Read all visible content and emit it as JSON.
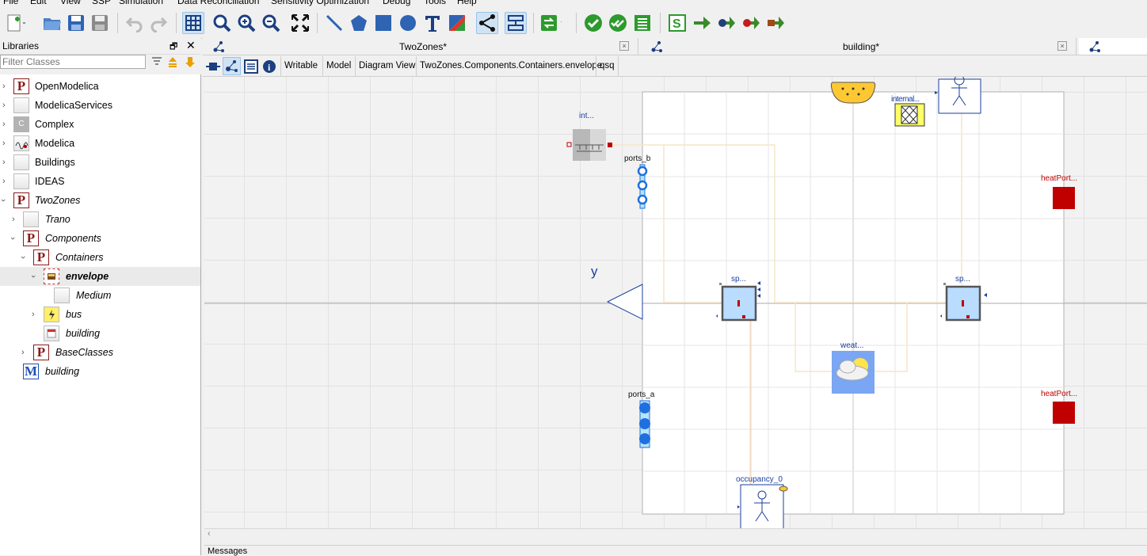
{
  "menu": {
    "items": [
      "File",
      "Edit",
      "View",
      "SSP",
      "Simulation",
      "Data Reconciliation",
      "Sensitivity Optimization",
      "Debug",
      "Tools",
      "Help"
    ]
  },
  "libraries": {
    "title": "Libraries",
    "filter_placeholder": "Filter Classes",
    "tree": [
      {
        "label": "OpenModelica",
        "icon": "package-icon",
        "arrow": "chevron-right-icon"
      },
      {
        "label": "ModelicaServices",
        "icon": "class-icon",
        "arrow": "chevron-right-icon"
      },
      {
        "label": "Complex",
        "icon": "complex-icon",
        "arrow": "chevron-right-icon"
      },
      {
        "label": "Modelica",
        "icon": "modelica-icon",
        "arrow": "chevron-right-icon"
      },
      {
        "label": "Buildings",
        "icon": "class-icon",
        "arrow": "chevron-right-icon"
      },
      {
        "label": "IDEAS",
        "icon": "class-icon",
        "arrow": "chevron-right-icon"
      },
      {
        "label": "TwoZones",
        "icon": "package-icon",
        "arrow": "chevron-down-icon"
      },
      {
        "label": "Trano",
        "icon": "class-icon",
        "arrow": "chevron-right-icon"
      },
      {
        "label": "Components",
        "icon": "package-icon",
        "arrow": "chevron-down-icon"
      },
      {
        "label": "Containers",
        "icon": "package-icon",
        "arrow": "chevron-down-icon"
      },
      {
        "label": "envelope",
        "icon": "envelope-icon",
        "arrow": "chevron-down-icon"
      },
      {
        "label": "Medium",
        "icon": "class-icon",
        "arrow": ""
      },
      {
        "label": "bus",
        "icon": "bus-icon",
        "arrow": "chevron-right-icon"
      },
      {
        "label": "building",
        "icon": "building-icon",
        "arrow": ""
      },
      {
        "label": "BaseClasses",
        "icon": "package-icon",
        "arrow": "chevron-right-icon"
      },
      {
        "label": "building",
        "icon": "model-icon",
        "arrow": ""
      }
    ]
  },
  "tabs": [
    {
      "label": "TwoZones*",
      "close": "×"
    },
    {
      "label": "building*",
      "close": "×"
    }
  ],
  "viewbar": {
    "labels": [
      "Writable",
      "Model",
      "Diagram View",
      "TwoZones.Components.Containers.envelope",
      "qsq"
    ]
  },
  "diagram": {
    "int_label": "int...",
    "ports_b_label": "ports_b",
    "ports_a_label": "ports_a",
    "y_label": "y",
    "sp1_label": "sp...",
    "sp2_label": "sp...",
    "weat_label": "weat...",
    "internal_label": "internal...",
    "heatport_top_label": "heatPort...",
    "heatport_bottom_label": "heatPort...",
    "occupancy_label": "occupancy_0",
    "colors": {
      "heatport": "#c00000",
      "fluid_port": "#1f6fe0",
      "connector_line": "#f5e6c8"
    }
  },
  "messages": {
    "title": "Messages"
  }
}
